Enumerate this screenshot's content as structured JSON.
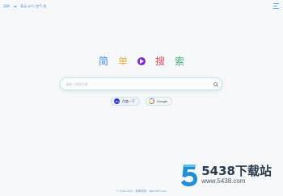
{
  "header": {
    "weather_label": "深圳",
    "weather_text": "多云 26°C 空气 良"
  },
  "logo": {
    "char1": "简",
    "char2": "单",
    "char3": "搜",
    "char4": "索"
  },
  "search": {
    "placeholder": "请输入搜索内容",
    "value": ""
  },
  "engines": [
    {
      "label": "百度一下",
      "icon": "du"
    },
    {
      "label": "Google",
      "icon": ""
    }
  ],
  "footer": {
    "copyright": "© 2018-2022",
    "author": "简单搜索",
    "link": "dijia.html.com"
  },
  "watermark": {
    "title": "5438下载站",
    "url": "www.5438.com"
  },
  "colors": {
    "accent": "#4fb3c6",
    "logo_blue": "#3f8fe2",
    "logo_yellow": "#e2b44a",
    "logo_red": "#d54b5a",
    "logo_green": "#3fb37b",
    "baidu_blue": "#2932e1"
  }
}
